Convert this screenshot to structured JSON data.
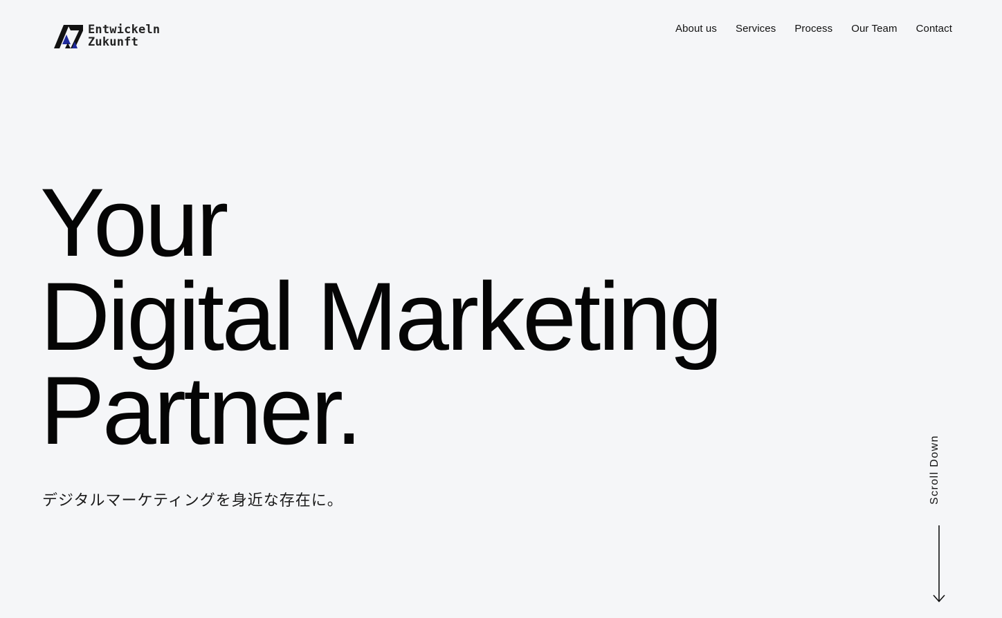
{
  "header": {
    "logo": {
      "line1": "Entwickeln",
      "line2": "Zukunft",
      "icon": "az-monogram-logo"
    },
    "nav": [
      {
        "label": "About us"
      },
      {
        "label": "Services"
      },
      {
        "label": "Process"
      },
      {
        "label": "Our Team"
      },
      {
        "label": "Contact"
      }
    ]
  },
  "hero": {
    "line1": "Your",
    "line2": "Digital Marketing",
    "line3": "Partner.",
    "tagline": "デジタルマーケティングを身近な存在に。"
  },
  "scroll": {
    "label": "Scroll Down",
    "icon": "arrow-down-icon"
  },
  "colors": {
    "background": "#f5f6f8",
    "text": "#0a0a0a",
    "logo_accent": "#1f2a9c"
  }
}
